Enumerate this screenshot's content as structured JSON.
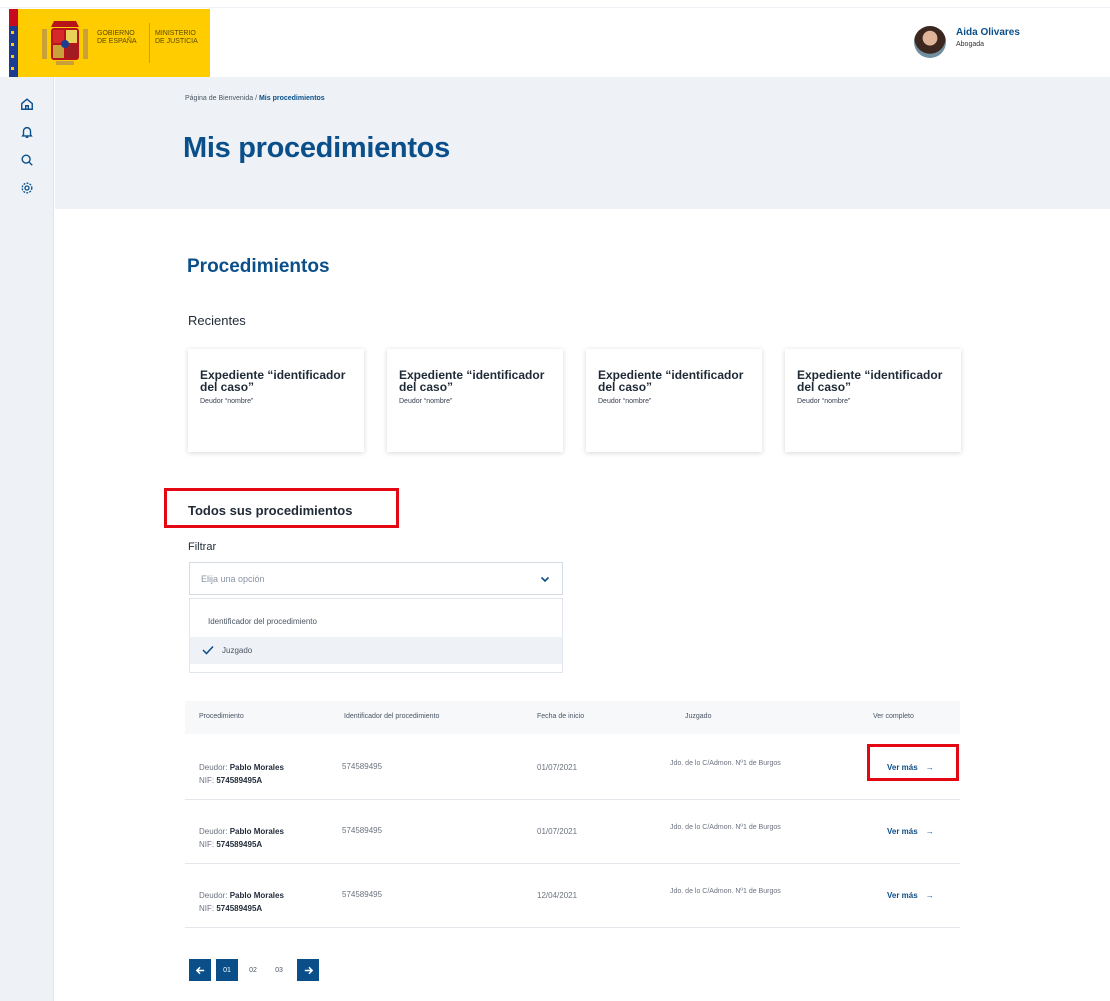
{
  "header": {
    "gov_line1": "GOBIERNO",
    "gov_line2": "DE ESPAÑA",
    "min_line1": "MINISTERIO",
    "min_line2": "DE JUSTICIA",
    "user_name": "Aida Olivares",
    "user_role": "Abogada"
  },
  "sidebar": {
    "icons": [
      "home-icon",
      "bell-icon",
      "search-icon",
      "gear-icon"
    ]
  },
  "breadcrumb": {
    "home": "Página de Bienvenida",
    "separator": " / ",
    "current": "Mis procedimientos"
  },
  "page": {
    "title": "Mis procedimientos",
    "section_title": "Procedimientos",
    "recent_title": "Recientes",
    "all_title": "Todos sus procedimientos"
  },
  "cards": [
    {
      "title": "Expediente “identificador del caso”",
      "subtitle": "Deudor “nombre”"
    },
    {
      "title": "Expediente “identificador del caso”",
      "subtitle": "Deudor “nombre”"
    },
    {
      "title": "Expediente “identificador del caso”",
      "subtitle": "Deudor “nombre”"
    },
    {
      "title": "Expediente “identificador del caso”",
      "subtitle": "Deudor “nombre”"
    }
  ],
  "filter": {
    "label": "Filtrar",
    "placeholder": "Elija una opción",
    "options": [
      {
        "label": "Identificador del procedimiento",
        "selected": false
      },
      {
        "label": "Juzgado",
        "selected": true
      }
    ]
  },
  "table": {
    "headers": [
      "Procedimiento",
      "Identificador del procedimiento",
      "Fecha de inicio",
      "Juzgado",
      "Ver completo"
    ],
    "rows": [
      {
        "debtor_label": "Deudor: ",
        "debtor_name": "Pablo Morales",
        "nif_label": "NIF: ",
        "nif": "574589495A",
        "id": "574589495",
        "date": "01/07/2021",
        "court": "Jdo. de lo C/Admon. Nº1 de Burgos",
        "action": "Ver más"
      },
      {
        "debtor_label": "Deudor: ",
        "debtor_name": "Pablo Morales",
        "nif_label": "NIF: ",
        "nif": "574589495A",
        "id": "574589495",
        "date": "01/07/2021",
        "court": "Jdo. de lo C/Admon. Nº1 de Burgos",
        "action": "Ver más"
      },
      {
        "debtor_label": "Deudor: ",
        "debtor_name": "Pablo Morales",
        "nif_label": "NIF: ",
        "nif": "574589495A",
        "id": "574589495",
        "date": "12/04/2021",
        "court": "Jdo. de lo C/Admon. Nº1 de Burgos",
        "action": "Ver más"
      }
    ]
  },
  "pagination": {
    "pages": [
      "01",
      "02",
      "03"
    ],
    "active": "01"
  },
  "colors": {
    "brand_blue": "#0b4f8a",
    "gov_yellow": "#ffcc00",
    "highlight_red": "#e30613",
    "panel_gray": "#eef2f6"
  }
}
